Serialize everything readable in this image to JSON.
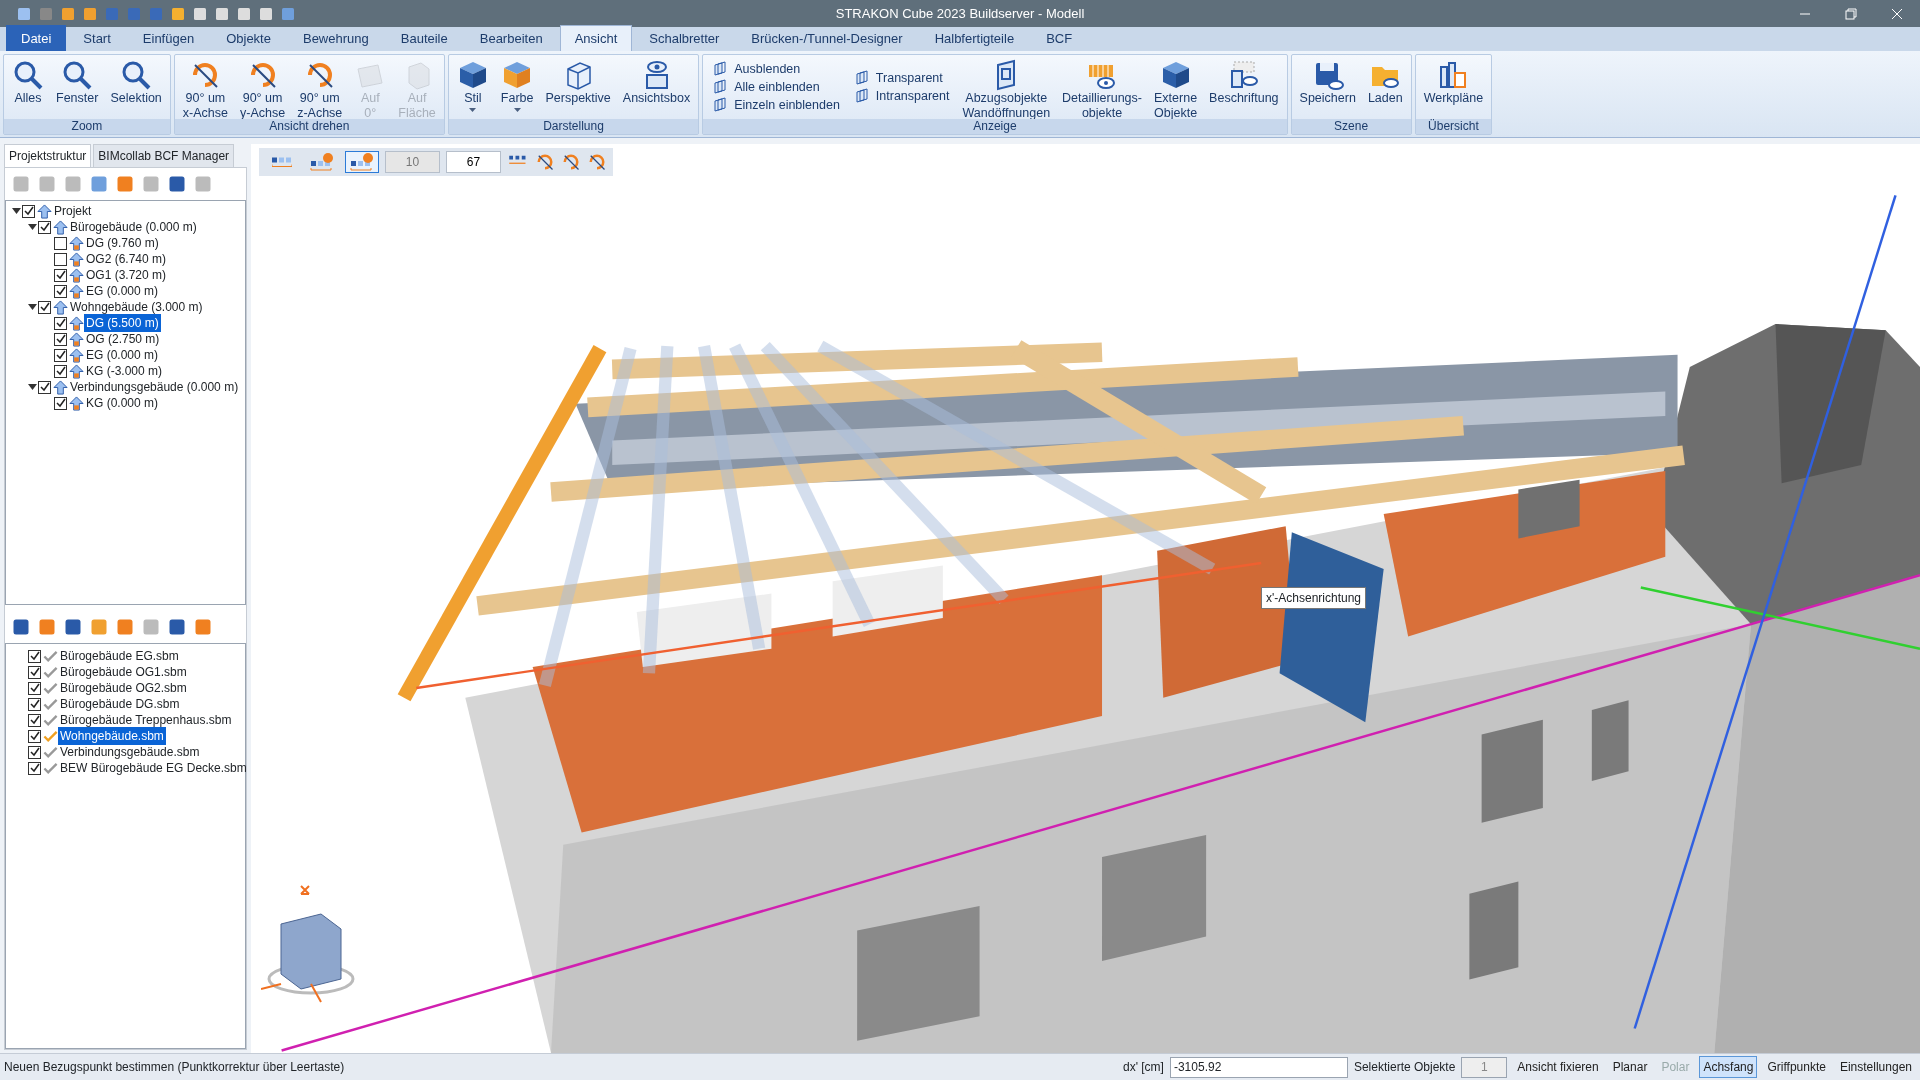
{
  "window": {
    "title": "STRAKON Cube 2023 Buildserver - Modell"
  },
  "menu_tabs": [
    {
      "label": "Datei",
      "kind": "file",
      "selected": false
    },
    {
      "label": "Start",
      "kind": "tab",
      "selected": false
    },
    {
      "label": "Einfügen",
      "kind": "tab",
      "selected": false
    },
    {
      "label": "Objekte",
      "kind": "tab",
      "selected": false
    },
    {
      "label": "Bewehrung",
      "kind": "tab",
      "selected": false
    },
    {
      "label": "Bauteile",
      "kind": "tab",
      "selected": false
    },
    {
      "label": "Bearbeiten",
      "kind": "tab",
      "selected": false
    },
    {
      "label": "Ansicht",
      "kind": "tab",
      "selected": true
    },
    {
      "label": "Schalbretter",
      "kind": "tab",
      "selected": false
    },
    {
      "label": "Brücken-/Tunnel-Designer",
      "kind": "tab",
      "selected": false
    },
    {
      "label": "Halbfertigteile",
      "kind": "tab",
      "selected": false
    },
    {
      "label": "BCF",
      "kind": "tab",
      "selected": false
    }
  ],
  "ribbon_groups": [
    {
      "title": "Zoom",
      "buttons": [
        {
          "label": "Alles",
          "kind": "large",
          "disabled": false
        },
        {
          "label": "Fenster",
          "kind": "large",
          "disabled": false
        },
        {
          "label": "Selektion",
          "kind": "large",
          "disabled": false
        }
      ]
    },
    {
      "title": "Ansicht drehen",
      "buttons": [
        {
          "label": "90° um\nx-Achse",
          "kind": "large",
          "disabled": false
        },
        {
          "label": "90° um\ny-Achse",
          "kind": "large",
          "disabled": false
        },
        {
          "label": "90° um\nz-Achse",
          "kind": "large",
          "disabled": false
        },
        {
          "label": "Auf\n0°",
          "kind": "large",
          "disabled": true
        },
        {
          "label": "Auf\nFläche",
          "kind": "large",
          "disabled": true
        }
      ]
    },
    {
      "title": "Darstellung",
      "buttons": [
        {
          "label": "Stil",
          "kind": "large",
          "disabled": false,
          "dropdown": true
        },
        {
          "label": "Farbe",
          "kind": "large",
          "disabled": false,
          "dropdown": true
        },
        {
          "label": "Perspektive",
          "kind": "large",
          "disabled": false
        },
        {
          "label": "Ansichtsbox",
          "kind": "large",
          "disabled": false
        }
      ]
    },
    {
      "title": "Anzeige",
      "buttons": [
        {
          "label": "Ausblenden",
          "kind": "small",
          "disabled": false
        },
        {
          "label": "Alle einblenden",
          "kind": "small",
          "disabled": false
        },
        {
          "label": "Einzeln einblenden",
          "kind": "small",
          "disabled": false
        },
        {
          "label": "Transparent",
          "kind": "small",
          "disabled": false
        },
        {
          "label": "Intransparent",
          "kind": "small",
          "disabled": false
        },
        {
          "label": "Abzugsobjekte\nWandöffnungen",
          "kind": "large",
          "disabled": false
        },
        {
          "label": "Detaillierungs-\nobjekte",
          "kind": "large",
          "disabled": false
        },
        {
          "label": "Externe\nObjekte",
          "kind": "large",
          "disabled": false
        },
        {
          "label": "Beschriftung",
          "kind": "large",
          "disabled": false
        }
      ]
    },
    {
      "title": "Szene",
      "buttons": [
        {
          "label": "Speichern",
          "kind": "large",
          "disabled": false
        },
        {
          "label": "Laden",
          "kind": "large",
          "disabled": false
        }
      ]
    },
    {
      "title": "Übersicht",
      "buttons": [
        {
          "label": "Werkpläne",
          "kind": "large",
          "disabled": false
        }
      ]
    }
  ],
  "left_panel": {
    "tabs": [
      {
        "label": "Projektstruktur",
        "selected": true
      },
      {
        "label": "BIMcollab BCF Manager",
        "selected": false
      }
    ],
    "tree": [
      {
        "label": "Projekt",
        "checked": true,
        "selected": false,
        "expanded": true,
        "children": [
          {
            "label": "Bürogebäude (0.000 m)",
            "checked": true,
            "selected": false,
            "expanded": true,
            "children": [
              {
                "label": "DG (9.760 m)",
                "checked": false,
                "selected": false
              },
              {
                "label": "OG2 (6.740 m)",
                "checked": false,
                "selected": false
              },
              {
                "label": "OG1 (3.720 m)",
                "checked": true,
                "selected": false
              },
              {
                "label": "EG (0.000 m)",
                "checked": true,
                "selected": false
              }
            ]
          },
          {
            "label": "Wohngebäude (3.000 m)",
            "checked": true,
            "selected": false,
            "expanded": true,
            "children": [
              {
                "label": "DG (5.500 m)",
                "checked": true,
                "selected": true
              },
              {
                "label": "OG (2.750 m)",
                "checked": true,
                "selected": false
              },
              {
                "label": "EG (0.000 m)",
                "checked": true,
                "selected": false
              },
              {
                "label": "KG (-3.000 m)",
                "checked": true,
                "selected": false
              }
            ]
          },
          {
            "label": "Verbindungsgebäude (0.000 m)",
            "checked": true,
            "selected": false,
            "expanded": true,
            "children": [
              {
                "label": "KG (0.000 m)",
                "checked": true,
                "selected": false
              }
            ]
          }
        ]
      }
    ],
    "files": [
      {
        "label": "Bürogebäude EG.sbm",
        "checked": true,
        "selected": false
      },
      {
        "label": "Bürogebäude OG1.sbm",
        "checked": true,
        "selected": false
      },
      {
        "label": "Bürogebäude OG2.sbm",
        "checked": true,
        "selected": false
      },
      {
        "label": "Bürogebäude DG.sbm",
        "checked": true,
        "selected": false
      },
      {
        "label": "Bürogebäude Treppenhaus.sbm",
        "checked": true,
        "selected": false
      },
      {
        "label": "Wohngebäude.sbm",
        "checked": true,
        "selected": true
      },
      {
        "label": "Verbindungsgebäude.sbm",
        "checked": true,
        "selected": false
      },
      {
        "label": "BEW Bürogebäude EG Decke.sbm",
        "checked": true,
        "selected": false
      }
    ]
  },
  "viewport": {
    "mode_buttons": [
      {
        "selected": false
      },
      {
        "selected": false
      },
      {
        "selected": true
      }
    ],
    "fields": [
      {
        "value": "10",
        "disabled": true
      },
      {
        "value": "67",
        "disabled": false
      }
    ],
    "tooltip": "x'-Achsenrichtung"
  },
  "status_bar": {
    "message": "Neuen Bezugspunkt bestimmen (Punktkorrektur über Leertaste)",
    "dx_label": "dx' [cm]",
    "dx_value": "-3105.92",
    "count_label": "Selektierte Objekte",
    "count_value": "1",
    "toggles": [
      {
        "label": "Ansicht fixieren",
        "selected": false,
        "disabled": false
      },
      {
        "label": "Planar",
        "selected": false,
        "disabled": false
      },
      {
        "label": "Polar",
        "selected": false,
        "disabled": true
      },
      {
        "label": "Achsfang",
        "selected": true,
        "disabled": false
      },
      {
        "label": "Griffpunkte",
        "selected": false,
        "disabled": false
      },
      {
        "label": "Einstellungen",
        "selected": false,
        "disabled": false
      }
    ]
  }
}
